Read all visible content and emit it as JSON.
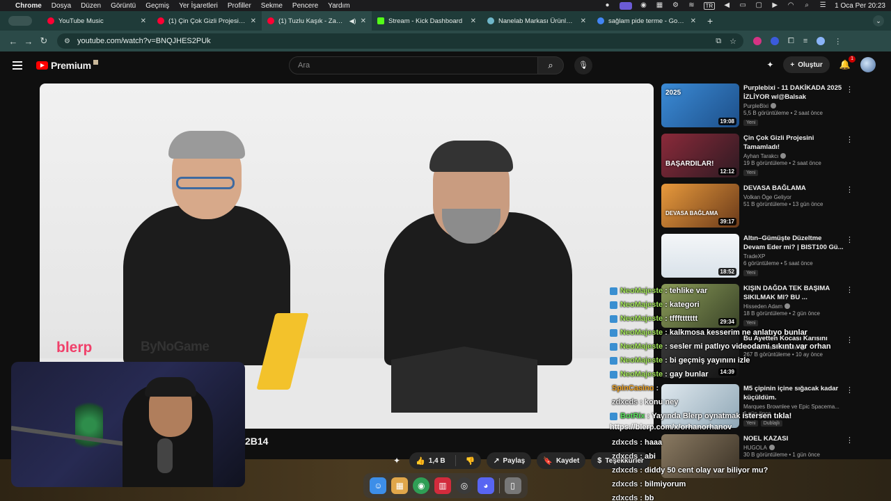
{
  "menubar": {
    "app": "Chrome",
    "items": [
      "Dosya",
      "Düzen",
      "Görüntü",
      "Geçmiş",
      "Yer İşaretleri",
      "Profiller",
      "Sekme",
      "Pencere",
      "Yardım"
    ],
    "lang": "TR",
    "datetime": "1 Oca Per  20:23"
  },
  "tabs": [
    {
      "label": "YouTube Music",
      "color": "#ff0033"
    },
    {
      "label": "(1) Çin Çok Gizli Projesini Tam",
      "color": "#ff0033"
    },
    {
      "label": "(1) Tuzlu Kaşık - Zamazingo",
      "color": "#ff0033"
    },
    {
      "label": "Stream - Kick Dashboard",
      "color": "#53fc18"
    },
    {
      "label": "Nanelab Markası Ürünleri | Re",
      "color": "#6fb6c9"
    },
    {
      "label": "sağlam pide terme - Google'da",
      "color": "#4285f4"
    }
  ],
  "address": {
    "url": "youtube.com/watch?v=BNQJHES2PUk"
  },
  "yt": {
    "brand": "Premium",
    "search_placeholder": "Ara",
    "create_label": "Oluştur",
    "notif_count": "1"
  },
  "player": {
    "watermark_blerp": "blerp",
    "watermark_byno": "ByNoGame"
  },
  "video": {
    "title_fragment": "2B14",
    "like_count": "1,4 B",
    "share_label": "Paylaş",
    "save_label": "Kaydet",
    "thanks_label": "Teşekkürler"
  },
  "recommendations": [
    {
      "title": "Purplebixi - 11 DAKİKADA 2025 İZLİYOR w/@Balsak",
      "channel": "PurpleBixi",
      "meta": "5,5 B görüntüleme • 2 saat önce",
      "badge": "Yeni",
      "duration": "19:08",
      "thumb_text": "2025",
      "color": "#3b8bd6"
    },
    {
      "title": "Çin Çok Gizli Projesini Tamamladı!",
      "channel": "Ayhan Tarakcı",
      "meta": "19 B görüntüleme • 2 saat önce",
      "badge": "Yeni",
      "duration": "12:12",
      "thumb_text": "BAŞARDILAR!",
      "color": "#6d2330"
    },
    {
      "title": "DEVASA BAĞLAMA",
      "channel": "Volkan Öge Geliyor",
      "meta": "51 B görüntüleme • 13 gün önce",
      "badge": "",
      "duration": "39:17",
      "thumb_text": "DEVASA BAĞLAMA",
      "color": "#d8832e"
    },
    {
      "title": "Altın–Gümüşte Düzeltme Devam Eder mi? | BIST100 Gü...",
      "channel": "TradeXP",
      "meta": "6 görüntüleme • 5 saat önce",
      "badge": "Yeni",
      "duration": "18:52",
      "thumb_text": "",
      "color": "#e9ecef"
    },
    {
      "title": "KIŞIN DAĞDA TEK BAŞIMA SIKILMAK MI? BU ...",
      "channel": "Hisseden Adam",
      "meta": "18 B görüntüleme • 2 gün önce",
      "badge": "Yeni",
      "duration": "29:34",
      "thumb_text": "",
      "color": "#6e7a4a"
    },
    {
      "title": "Bu Ayetten Kocası Karısını",
      "channel": "HT Bilim Tarih Felsefe",
      "meta": "267 B görüntüleme • 10 ay önce",
      "badge": "",
      "duration": "14:39",
      "thumb_text": "",
      "color": "#2a2a2a"
    },
    {
      "title": "M5 çipinin içine sığacak kadar küçüldüm.",
      "channel": "Marques Brownlee ve Epic Spacema...",
      "meta": "6 gün önce",
      "badge": "Yeni",
      "badge2": "Dublajlı",
      "duration": "",
      "thumb_text": "",
      "color": "#c9d5de"
    },
    {
      "title": "NOEL KAZASI",
      "channel": "HUGOLA",
      "meta": "30 B görüntüleme • 1 gün önce",
      "badge": "",
      "duration": "",
      "thumb_text": "",
      "color": "#7c6b55"
    }
  ],
  "chat": [
    {
      "user": "NeoMajeste",
      "msg": "tehlike var",
      "color": "#a4e65b",
      "badge": true
    },
    {
      "user": "NeoMajeste",
      "msg": "kategori",
      "color": "#a4e65b",
      "badge": true
    },
    {
      "user": "NeoMajeste",
      "msg": "tfffttttttt",
      "color": "#a4e65b",
      "badge": true
    },
    {
      "user": "NeoMajeste",
      "msg": "kalkmosa kesserim ne anlatıyo bunlar",
      "color": "#a4e65b",
      "badge": true
    },
    {
      "user": "NeoMajeste",
      "msg": "sesler mi patlıyo videodami sıkıntı var orhan",
      "color": "#a4e65b",
      "badge": true
    },
    {
      "user": "NeoMajeste",
      "msg": "bi geçmiş yayınını izle",
      "color": "#a4e65b",
      "badge": true
    },
    {
      "user": "NeoMajeste",
      "msg": "gay bunlar",
      "color": "#a4e65b",
      "badge": true
    },
    {
      "user": "SpinCasino",
      "msg": "",
      "color": "#f5a623",
      "badge": false
    },
    {
      "user": "zdxcds",
      "msg": "konu ney",
      "color": "#e6e6e6",
      "badge": false
    },
    {
      "user": "BotRix",
      "msg": "Yayında Blerp oynatmak istersen tıkla!",
      "color": "#59e05c",
      "badge": true
    },
    {
      "user": "",
      "msg": "https://blerp.com/x/orhanorhanov",
      "color": "#ffffff",
      "badge": false
    },
    {
      "user": "zdxcds",
      "msg": "haaa",
      "color": "#e6e6e6",
      "badge": false
    },
    {
      "user": "zdxcds",
      "msg": "abi",
      "color": "#e6e6e6",
      "badge": false
    },
    {
      "user": "zdxcds",
      "msg": "diddy 50 cent olay var biliyor mu?",
      "color": "#e6e6e6",
      "badge": false
    },
    {
      "user": "zdxcds",
      "msg": "bilmiyorum",
      "color": "#e6e6e6",
      "badge": false
    },
    {
      "user": "zdxcds",
      "msg": "bb",
      "color": "#e6e6e6",
      "badge": false
    }
  ],
  "dock": [
    {
      "name": "finder",
      "color": "#3d8ee8"
    },
    {
      "name": "launchpad",
      "color": "#e0a64a"
    },
    {
      "name": "chrome",
      "color": "#2f9e55"
    },
    {
      "name": "kick",
      "color": "#d22b3c"
    },
    {
      "name": "obs",
      "color": "#3a3a3a"
    },
    {
      "name": "discord",
      "color": "#5865f2"
    }
  ]
}
